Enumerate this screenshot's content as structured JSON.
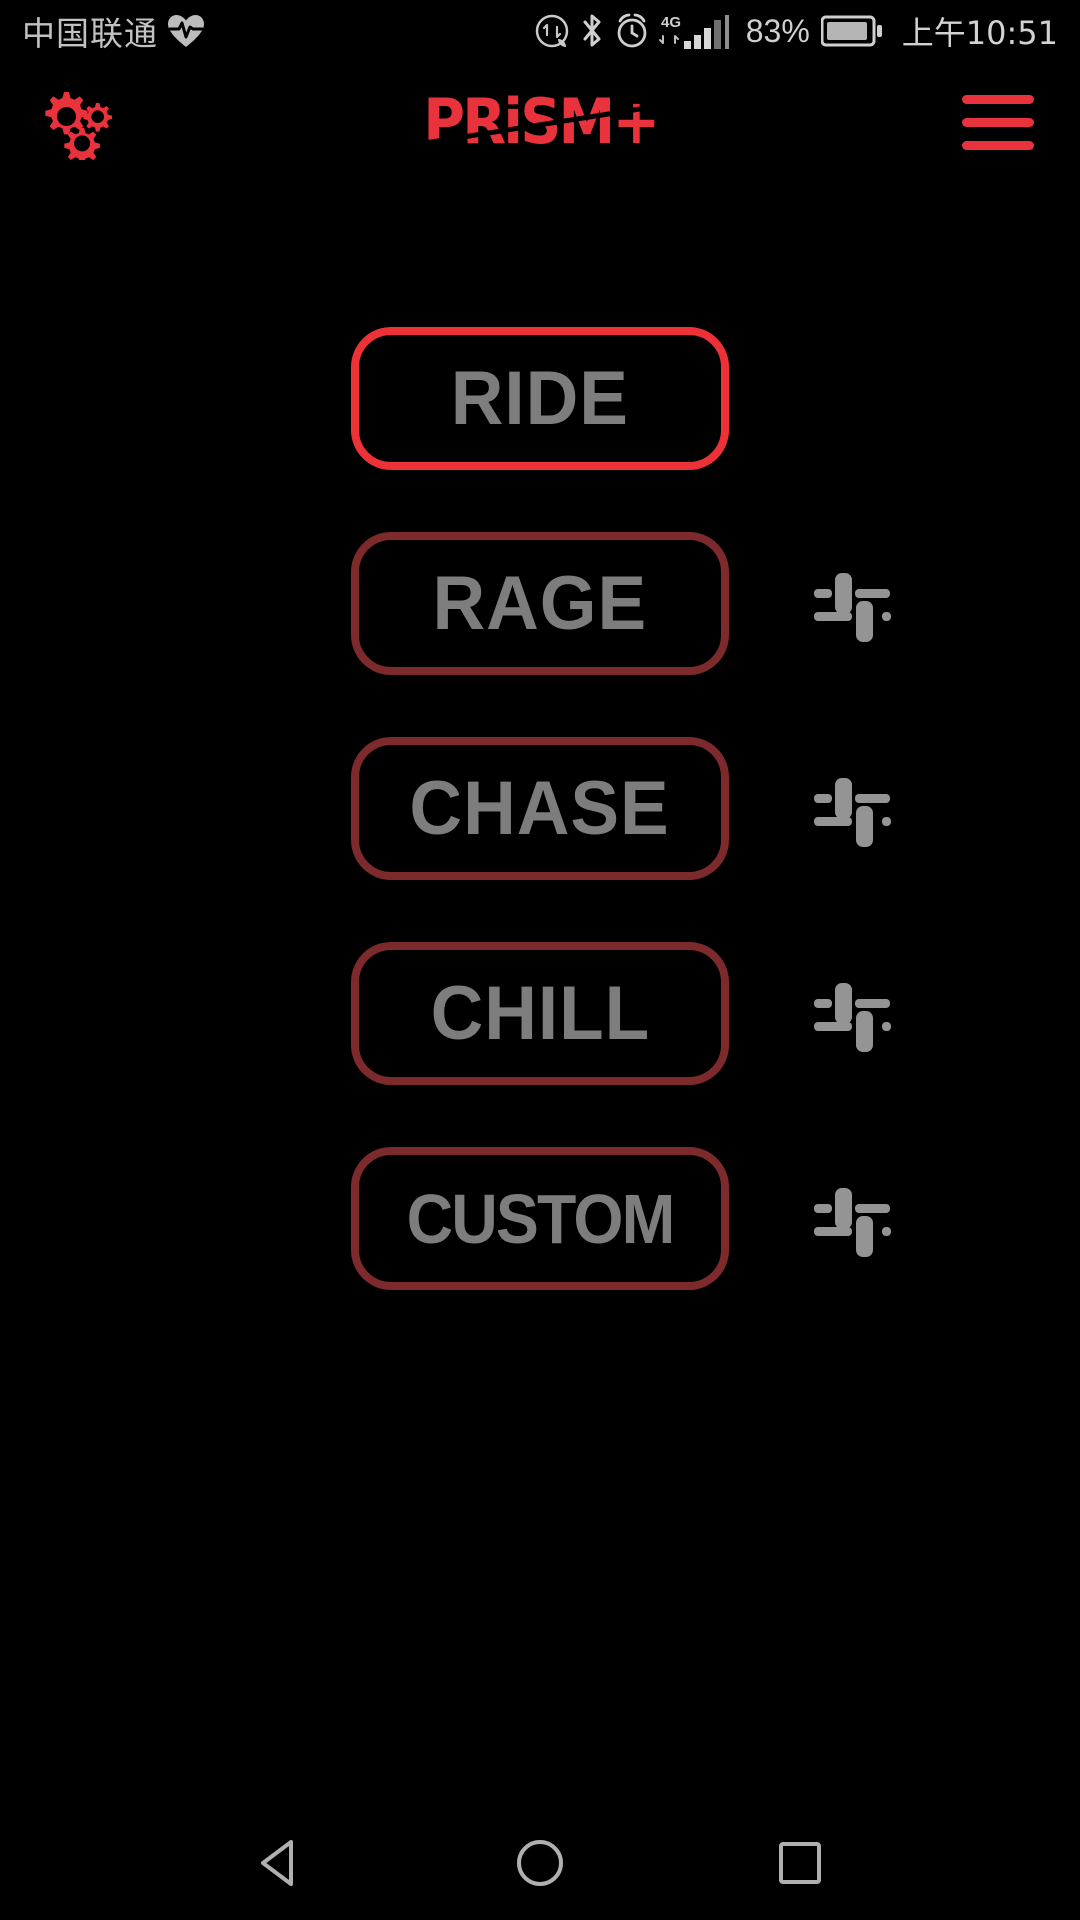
{
  "status_bar": {
    "carrier": "中国联通",
    "health_icon": "heart-rate-icon",
    "data_saver_icon": "data-saver-icon",
    "bluetooth_icon": "bluetooth-icon",
    "alarm_icon": "alarm-clock-icon",
    "network_type": "4G",
    "signal_icon": "signal-bars-icon",
    "battery_percent": "83%",
    "battery_icon": "battery-icon",
    "time": "上午10:51"
  },
  "app_bar": {
    "settings_icon": "gears-icon",
    "logo_text": "PRiSM+",
    "menu_icon": "hamburger-menu-icon",
    "accent_color": "#ed3237",
    "inactive_color": "#7c2a2c"
  },
  "modes": {
    "items": [
      {
        "label": "RIDE",
        "active": true,
        "has_tune": false,
        "tune_icon": "tune-sliders-icon"
      },
      {
        "label": "RAGE",
        "active": false,
        "has_tune": true,
        "tune_icon": "tune-sliders-icon"
      },
      {
        "label": "CHASE",
        "active": false,
        "has_tune": true,
        "tune_icon": "tune-sliders-icon"
      },
      {
        "label": "CHILL",
        "active": false,
        "has_tune": true,
        "tune_icon": "tune-sliders-icon"
      },
      {
        "label": "CUSTOM",
        "active": false,
        "has_tune": true,
        "tune_icon": "tune-sliders-icon"
      }
    ],
    "label_color": "#7d7d7d"
  },
  "nav_bar": {
    "back": "back-triangle-icon",
    "home": "home-circle-icon",
    "recents": "recents-square-icon"
  }
}
